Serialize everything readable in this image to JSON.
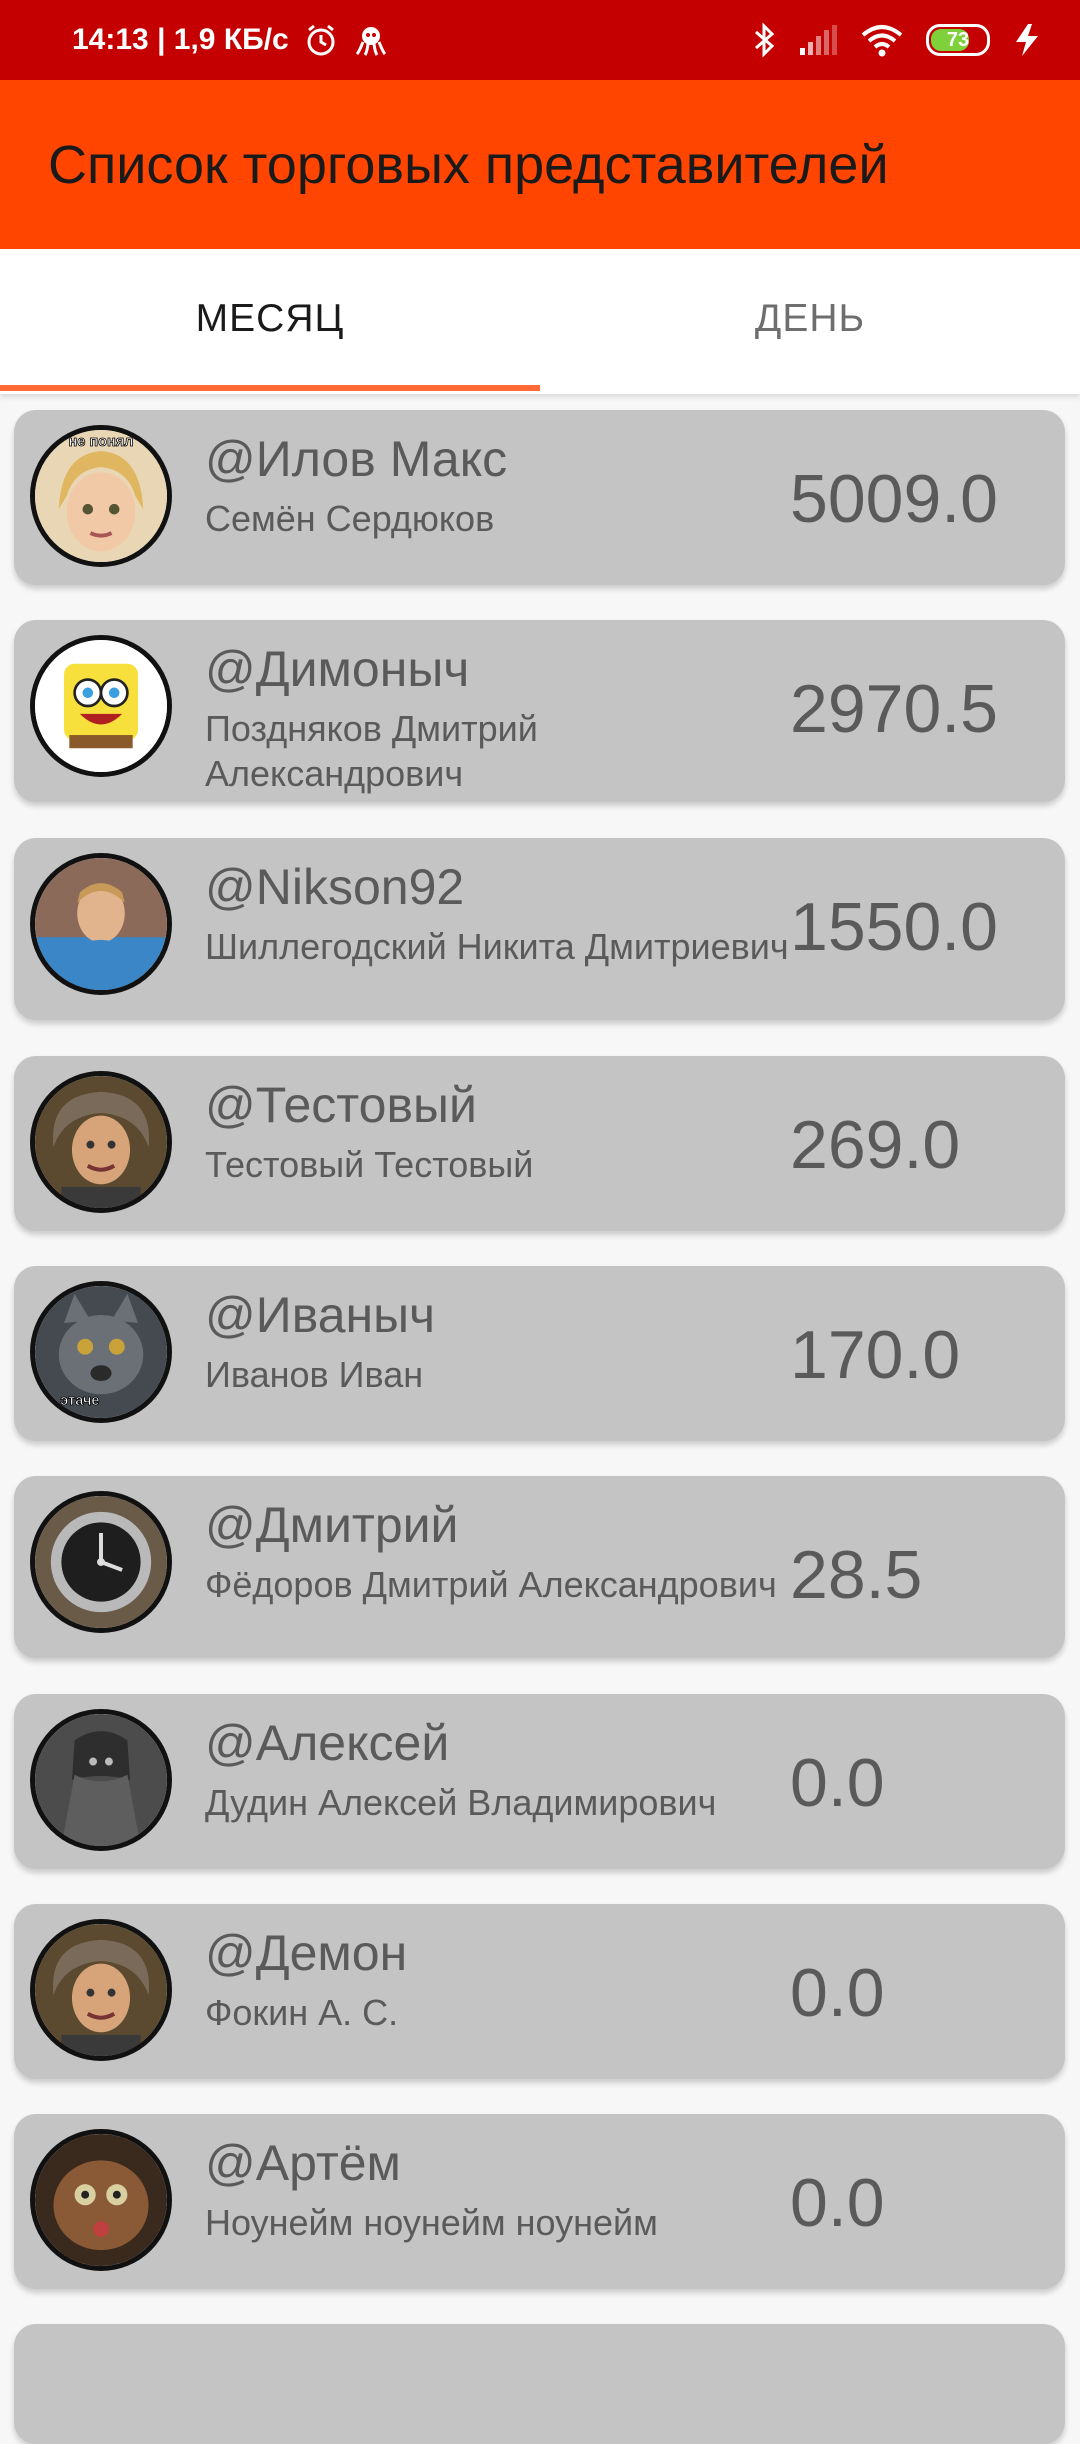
{
  "status_bar": {
    "time_speed": "14:13 | 1,9 КБ/с",
    "icons_left": [
      "alarm-icon",
      "octopus-icon"
    ],
    "icons_right": [
      "bluetooth-icon",
      "signal-icon",
      "wifi-icon",
      "battery-icon",
      "charging-icon"
    ],
    "battery_level": "73",
    "battery_fraction": 0.73
  },
  "app_bar": {
    "title": "Список торговых представителей",
    "color": "#ff4500"
  },
  "tabs": [
    {
      "label": "МЕСЯЦ",
      "selected": true
    },
    {
      "label": "ДЕНЬ",
      "selected": false
    }
  ],
  "accent_color": "#ff6a35",
  "reps": [
    {
      "nick": "@Илов Макс",
      "name": "Семён Сердюков",
      "score": "5009.0",
      "avatar_overlay": "не понял",
      "avatar_icon": "girl-avatar"
    },
    {
      "nick": "@Димоныч",
      "name": "Поздняков Дмитрий Александрович",
      "score": "2970.5",
      "avatar_overlay": "",
      "avatar_icon": "sponge-avatar"
    },
    {
      "nick": "@Nikson92",
      "name": "Шиллегодский Никита Дмитриевич",
      "score": "1550.0",
      "avatar_overlay": "",
      "avatar_icon": "man-avatar"
    },
    {
      "nick": "@Тестовый",
      "name": "Тестовый Тестовый",
      "score": "269.0",
      "avatar_overlay": "",
      "avatar_icon": "man-hair-avatar"
    },
    {
      "nick": "@Иваныч",
      "name": "Иванов Иван",
      "score": "170.0",
      "avatar_overlay": "этаче",
      "avatar_icon": "cat-avatar"
    },
    {
      "nick": "@Дмитрий",
      "name": "Фёдоров Дмитрий Александрович",
      "score": "28.5",
      "avatar_overlay": "",
      "avatar_icon": "watch-avatar"
    },
    {
      "nick": "@Алексей",
      "name": "Дудин Алексей Владимирович",
      "score": "0.0",
      "avatar_overlay": "",
      "avatar_icon": "knight-avatar"
    },
    {
      "nick": "@Демон",
      "name": "Фокин А. С.",
      "score": "0.0",
      "avatar_overlay": "",
      "avatar_icon": "man-hair-avatar"
    },
    {
      "nick": "@Артём",
      "name": "Ноунейм ноунейм ноунейм",
      "score": "0.0",
      "avatar_overlay": "",
      "avatar_icon": "furry-avatar"
    }
  ]
}
